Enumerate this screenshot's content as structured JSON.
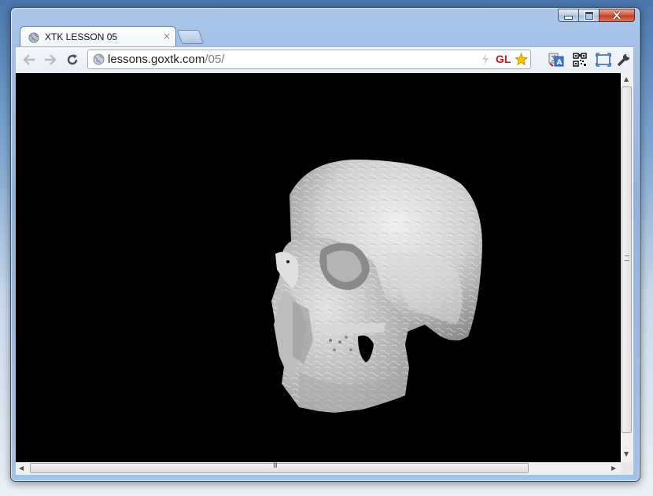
{
  "window": {
    "minimize_icon": "minimize-icon",
    "maximize_icon": "maximize-icon",
    "close_icon": "close-icon"
  },
  "tab": {
    "title": "XTK LESSON 05",
    "close_glyph": "×",
    "favicon": "globe-icon"
  },
  "omnibox": {
    "host": "lessons.goxtk.com",
    "path": "/05/",
    "site_icon": "globe-icon"
  },
  "extensions": {
    "gl_label": "GL",
    "bolt_icon": "bolt-icon",
    "star_icon": "star-icon",
    "translate_icon": "translate-icon",
    "qr_icon": "qr-code-icon",
    "fullscreen_icon": "fullscreen-icon",
    "wrench_icon": "wrench-icon"
  },
  "scrollbars": {
    "grip_glyph": "III"
  },
  "viewport": {
    "content": "3D rendered skull"
  },
  "colors": {
    "gl_red": "#c0161b",
    "star_yellow": "#f2c200",
    "canvas_bg": "#000000"
  }
}
